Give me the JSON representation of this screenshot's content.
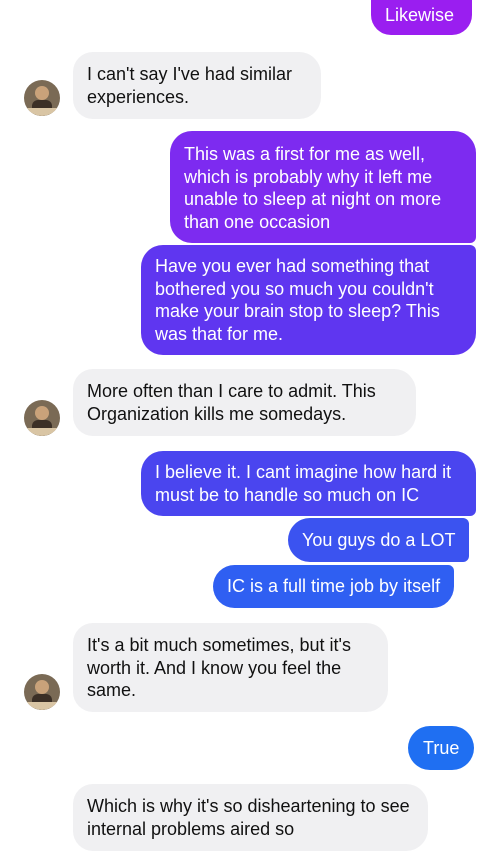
{
  "colors": {
    "incoming_bg": "#f0f0f2",
    "outgoing_purple": "#8f20ee",
    "outgoing_violet": "#6a2ff0",
    "outgoing_indigo": "#4b43ee",
    "outgoing_blue": "#2d5df0",
    "outgoing_true_blue": "#1f6ff2"
  },
  "messages": [
    {
      "id": "m1",
      "side": "out",
      "text": "Likewise"
    },
    {
      "id": "m2",
      "side": "in",
      "text": "I can't say I've had similar experiences."
    },
    {
      "id": "m3",
      "side": "out",
      "text": "This was a first for me as well, which is probably why it left me unable to sleep at night on more than one occasion"
    },
    {
      "id": "m4",
      "side": "out",
      "text": "Have you ever had something that bothered you so much you couldn't make your brain stop to sleep? This was that for me."
    },
    {
      "id": "m5",
      "side": "in",
      "text": "More often than I care to admit. This Organization kills me somedays."
    },
    {
      "id": "m6",
      "side": "out",
      "text": "I believe it. I cant imagine how hard it must be to handle so much on IC"
    },
    {
      "id": "m7",
      "side": "out",
      "text": "You guys do a LOT"
    },
    {
      "id": "m8",
      "side": "out",
      "text": "IC is a full time job by itself"
    },
    {
      "id": "m9",
      "side": "in",
      "text": "It's a bit much sometimes, but it's worth it. And I know you feel the same."
    },
    {
      "id": "m10",
      "side": "out",
      "text": "True"
    },
    {
      "id": "m11",
      "side": "in",
      "text": "Which is why it's so disheartening to see internal problems aired so"
    }
  ],
  "avatars": [
    "profile-avatar",
    "profile-avatar",
    "profile-avatar"
  ]
}
